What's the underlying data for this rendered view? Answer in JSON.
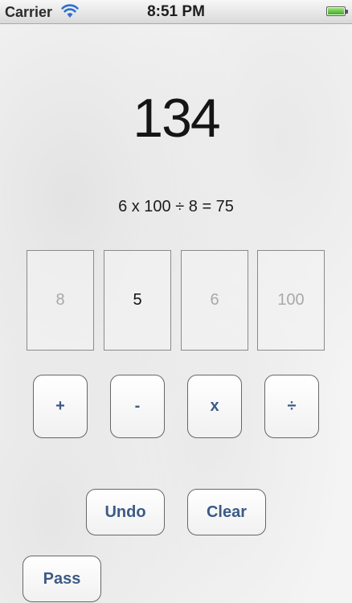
{
  "status_bar": {
    "carrier": "Carrier",
    "time": "8:51 PM",
    "wifi_icon": "wifi-icon",
    "battery_icon": "battery-icon",
    "battery_level": 1.0
  },
  "game": {
    "target": "134",
    "equation": "6 x 100 ÷ 8 = 75",
    "cards": [
      {
        "value": "8",
        "state": "used"
      },
      {
        "value": "5",
        "state": "active"
      },
      {
        "value": "6",
        "state": "used"
      },
      {
        "value": "100",
        "state": "used"
      }
    ],
    "operators": [
      "+",
      "-",
      "x",
      "÷"
    ],
    "undo_label": "Undo",
    "clear_label": "Clear",
    "pass_label": "Pass"
  },
  "colors": {
    "button_text": "#3d5a86",
    "used_card_text": "#a9a9a9",
    "active_card_text": "#111111"
  }
}
